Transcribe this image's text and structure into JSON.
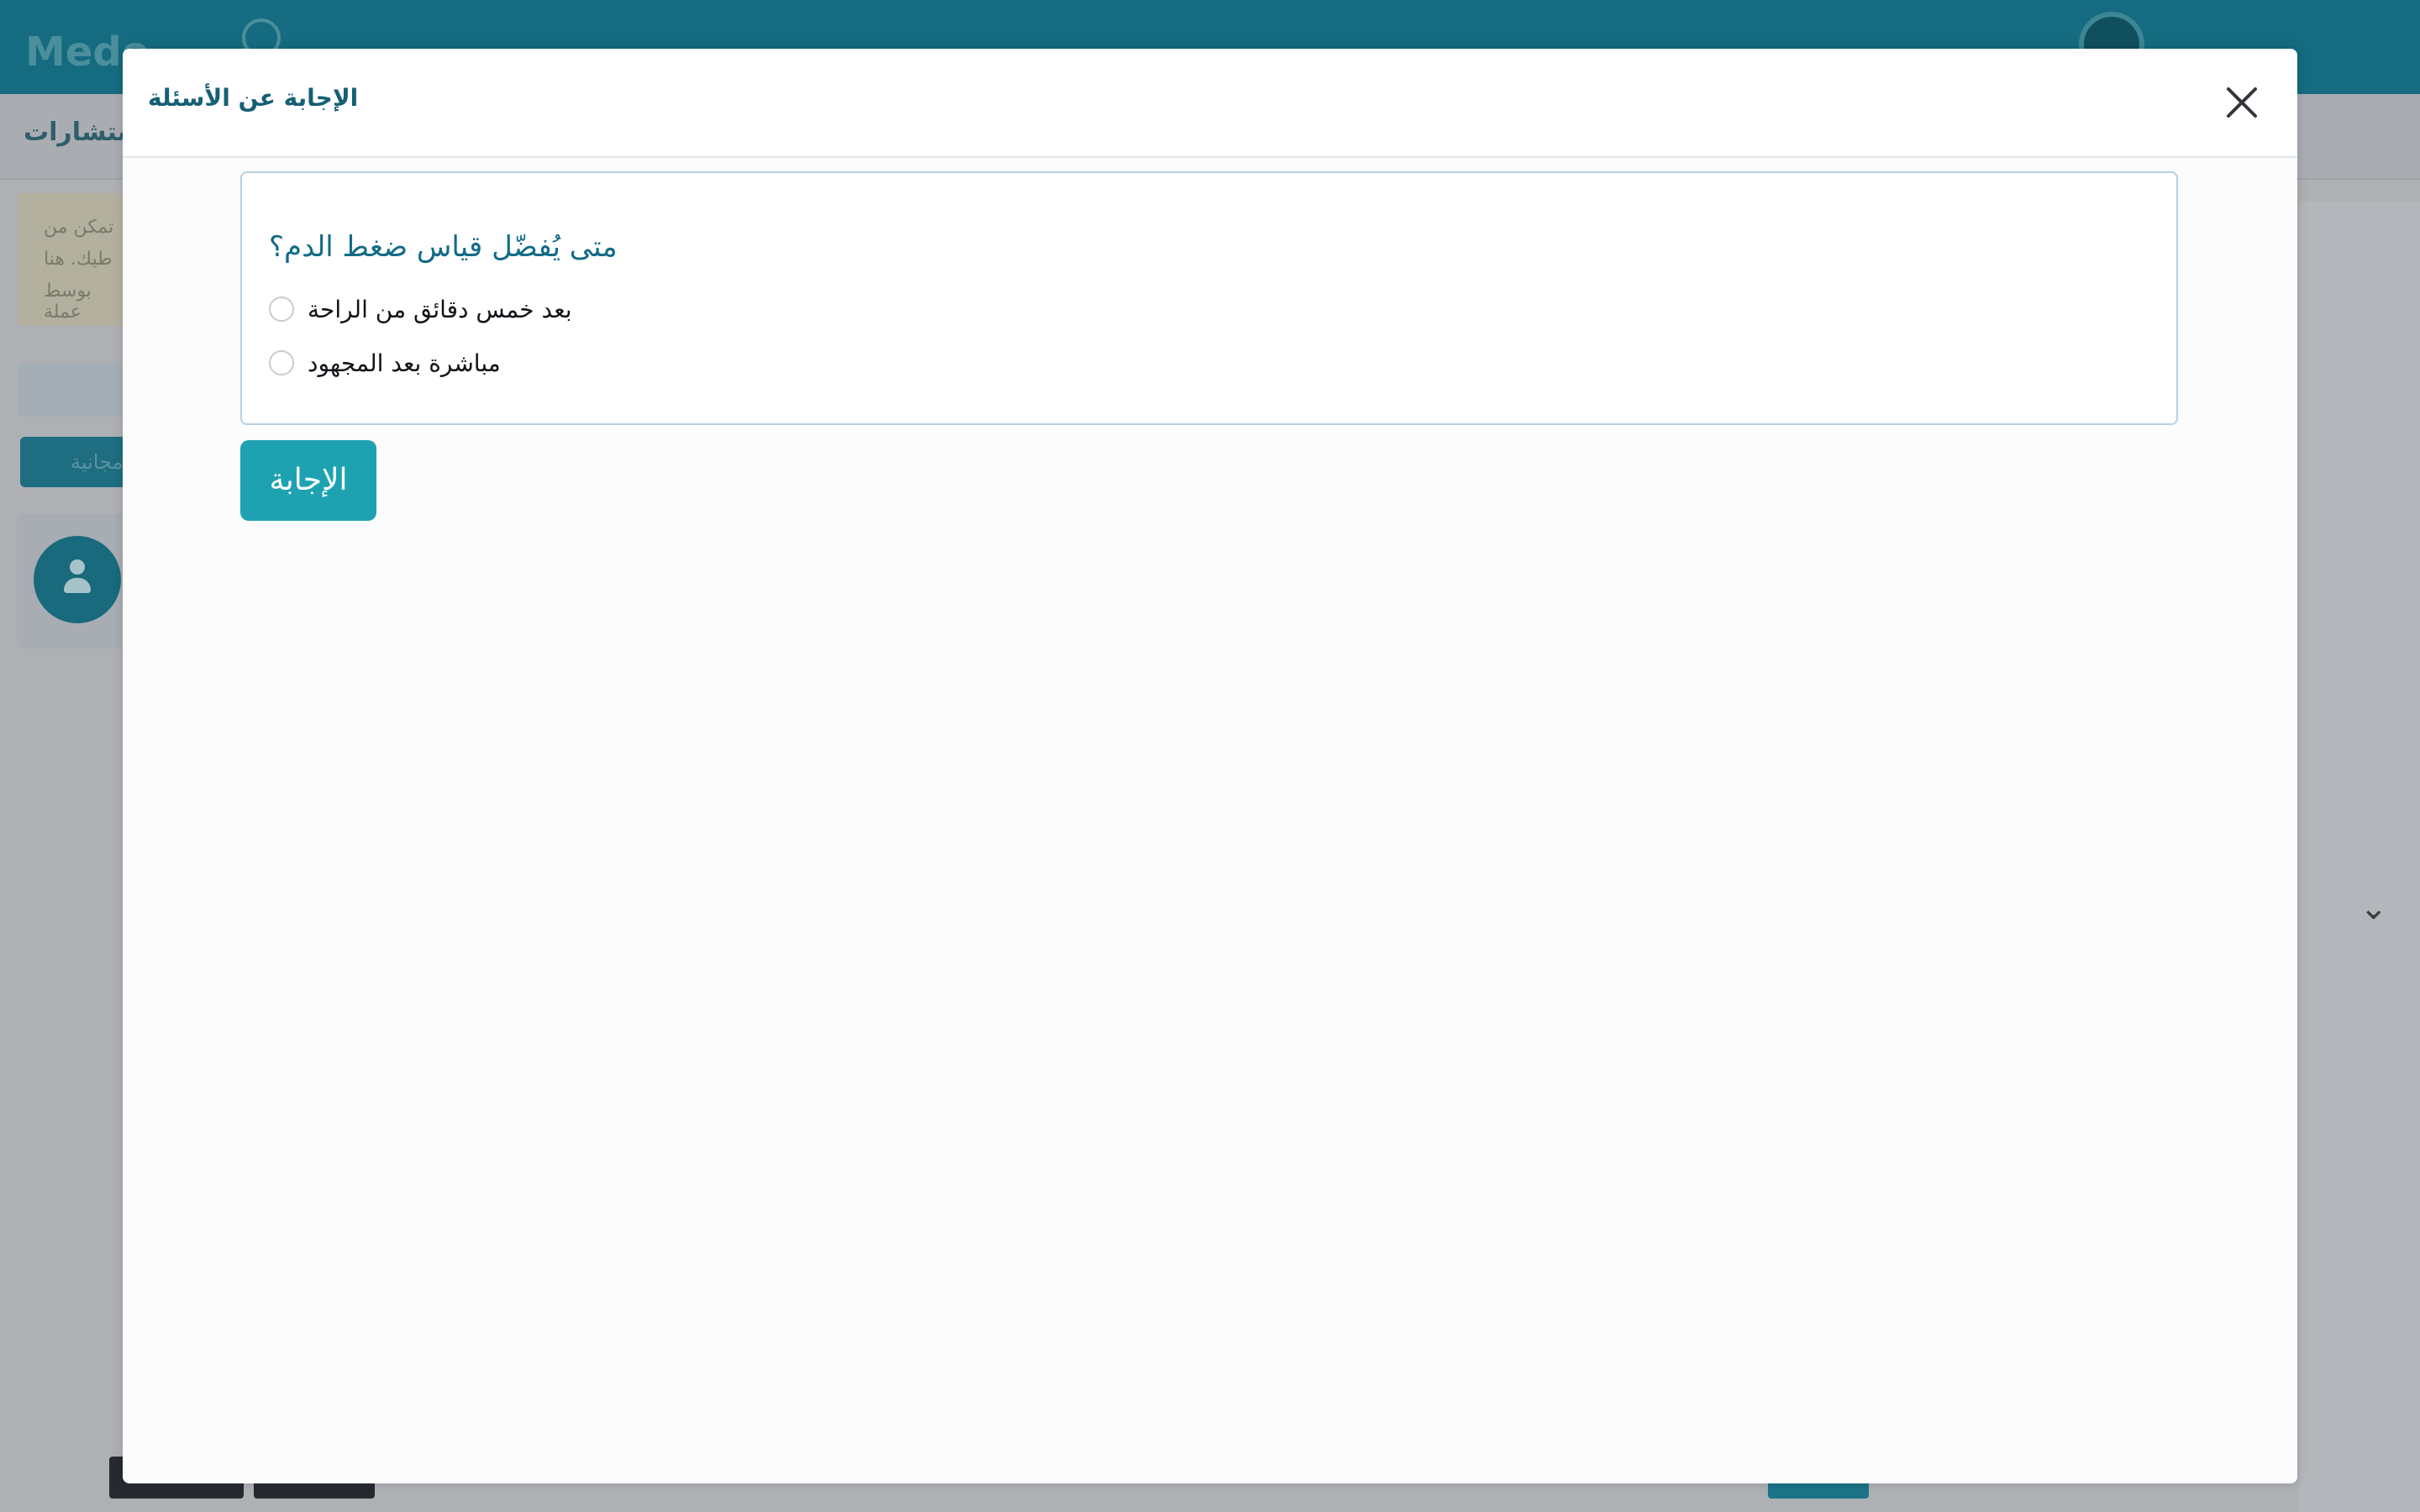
{
  "background": {
    "logo_text": "Medo",
    "subbar_text": "استشارات",
    "notice_lines": [
      "تمكن من",
      "طيك. هنا",
      "بوسط عملة"
    ],
    "tab_label": "مجانية"
  },
  "modal": {
    "title": "الإجابة عن الأسئلة",
    "close_icon": "close-icon",
    "question": {
      "text": "متى يُفضّل قياس ضغط الدم؟",
      "options": [
        {
          "label": "بعد خمس دقائق من الراحة",
          "selected": false
        },
        {
          "label": "مباشرة بعد المجهود",
          "selected": false
        }
      ]
    },
    "answer_button_label": "الإجابة"
  },
  "colors": {
    "header_teal": "#156b7f",
    "title_teal": "#155f74",
    "question_teal": "#136b86",
    "button_teal": "#1ea2b2",
    "card_border": "#b7cfe2"
  }
}
